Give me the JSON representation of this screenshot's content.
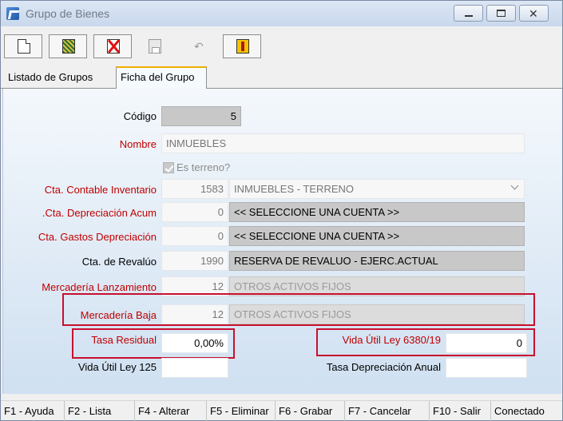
{
  "window": {
    "title": "Grupo de Bienes"
  },
  "tabs": [
    {
      "label": "Listado de Grupos"
    },
    {
      "label": "Ficha del Grupo"
    }
  ],
  "form": {
    "codigo": {
      "label": "Código",
      "value": "5"
    },
    "nombre": {
      "label": "Nombre",
      "value": "INMUEBLES"
    },
    "es_terreno": {
      "label": "Es terreno?",
      "checked": true
    },
    "cta_inventario": {
      "label": "Cta. Contable Inventario",
      "code": "1583",
      "name": "INMUEBLES - TERRENO"
    },
    "cta_depreciacion_acum": {
      "label": ".Cta. Depreciación Acum",
      "code": "0",
      "name": "<< SELECCIONE UNA CUENTA >>"
    },
    "cta_gastos_depreciacion": {
      "label": "Cta. Gastos Depreciación",
      "code": "0",
      "name": "<< SELECCIONE UNA CUENTA >>"
    },
    "cta_revaluo": {
      "label": "Cta. de Revalúo",
      "code": "1990",
      "name": "RESERVA DE REVALUO - EJERC.ACTUAL"
    },
    "mercaderia_lanzamiento": {
      "label": "Mercadería Lanzamiento",
      "code": "12",
      "name": "OTROS ACTIVOS FIJOS"
    },
    "mercaderia_baja": {
      "label": "Mercadería Baja",
      "code": "12",
      "name": "OTROS ACTIVOS FIJOS"
    },
    "tasa_residual": {
      "label": "Tasa Residual",
      "value": "0,00%"
    },
    "vida_util_6380": {
      "label": "Vida Útil Ley 6380/19",
      "value": "0"
    },
    "vida_util_125": {
      "label": "Vida Útil Ley 125",
      "value": ""
    },
    "tasa_depreciacion_anual": {
      "label": "Tasa Depreciación Anual",
      "value": ""
    }
  },
  "statusbar": [
    "F1 - Ayuda",
    "F2 - Lista",
    "F4 - Alterar",
    "F5 - Eliminar",
    "F6 - Grabar",
    "F7 - Cancelar",
    "F10 - Salir",
    "Conectado"
  ],
  "icons": {
    "app": "app-icon",
    "new": "new-document-icon",
    "edit": "edit-icon",
    "delete": "delete-icon",
    "save": "save-icon",
    "undo": "undo-icon",
    "exit": "exit-door-icon"
  },
  "colors": {
    "required_label": "#c00000",
    "highlight_box": "#c8102e",
    "active_tab_accent": "#f0b000"
  }
}
